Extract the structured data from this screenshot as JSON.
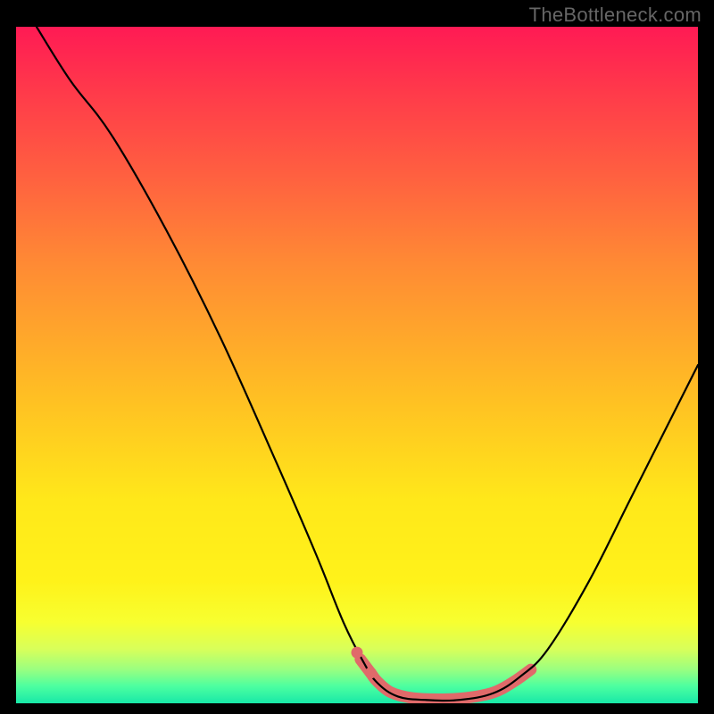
{
  "watermark": "TheBottleneck.com",
  "chart_data": {
    "type": "line",
    "title": "",
    "xlabel": "",
    "ylabel": "",
    "xlim": [
      0,
      100
    ],
    "ylim": [
      0,
      100
    ],
    "grid": false,
    "legend": false,
    "gradient_stops": [
      {
        "pct": 0,
        "color": "#ff1a54"
      },
      {
        "pct": 10,
        "color": "#ff3b4a"
      },
      {
        "pct": 22,
        "color": "#ff6040"
      },
      {
        "pct": 35,
        "color": "#ff8a34"
      },
      {
        "pct": 55,
        "color": "#ffc023"
      },
      {
        "pct": 70,
        "color": "#ffe81a"
      },
      {
        "pct": 82,
        "color": "#fff21a"
      },
      {
        "pct": 88,
        "color": "#f7ff30"
      },
      {
        "pct": 92,
        "color": "#d8ff5a"
      },
      {
        "pct": 95,
        "color": "#9aff80"
      },
      {
        "pct": 97.5,
        "color": "#4cffa0"
      },
      {
        "pct": 100,
        "color": "#18e8a8"
      }
    ],
    "series": [
      {
        "name": "bottleneck-curve",
        "stroke": "#000000",
        "stroke_width": 2.2,
        "points": [
          {
            "x": 3,
            "y": 100
          },
          {
            "x": 8,
            "y": 92
          },
          {
            "x": 14,
            "y": 84
          },
          {
            "x": 22,
            "y": 70
          },
          {
            "x": 30,
            "y": 54
          },
          {
            "x": 38,
            "y": 36
          },
          {
            "x": 44,
            "y": 22
          },
          {
            "x": 48,
            "y": 12
          },
          {
            "x": 51,
            "y": 6
          },
          {
            "x": 53,
            "y": 3
          },
          {
            "x": 56,
            "y": 1
          },
          {
            "x": 60,
            "y": 0.5
          },
          {
            "x": 65,
            "y": 0.5
          },
          {
            "x": 70,
            "y": 1.5
          },
          {
            "x": 74,
            "y": 4
          },
          {
            "x": 78,
            "y": 8
          },
          {
            "x": 84,
            "y": 18
          },
          {
            "x": 90,
            "y": 30
          },
          {
            "x": 96,
            "y": 42
          },
          {
            "x": 100,
            "y": 50
          }
        ]
      },
      {
        "name": "highlight-segment",
        "stroke": "#e06a6a",
        "stroke_width": 13,
        "linecap": "round",
        "points": [
          {
            "x": 50.5,
            "y": 6.5
          },
          {
            "x": 52,
            "y": 4.5
          },
          {
            "x": 53,
            "y": 3.2
          },
          {
            "x": 55,
            "y": 1.6
          },
          {
            "x": 58,
            "y": 0.8
          },
          {
            "x": 62,
            "y": 0.6
          },
          {
            "x": 66,
            "y": 0.8
          },
          {
            "x": 70,
            "y": 1.6
          },
          {
            "x": 73,
            "y": 3.2
          },
          {
            "x": 75.5,
            "y": 5.0
          }
        ]
      }
    ],
    "markers": [
      {
        "x": 50,
        "y": 7.5,
        "r": 6.5,
        "color": "#e06a6a"
      },
      {
        "x": 52,
        "y": 4.5,
        "r": 6.5,
        "color": "#e06a6a"
      }
    ]
  }
}
